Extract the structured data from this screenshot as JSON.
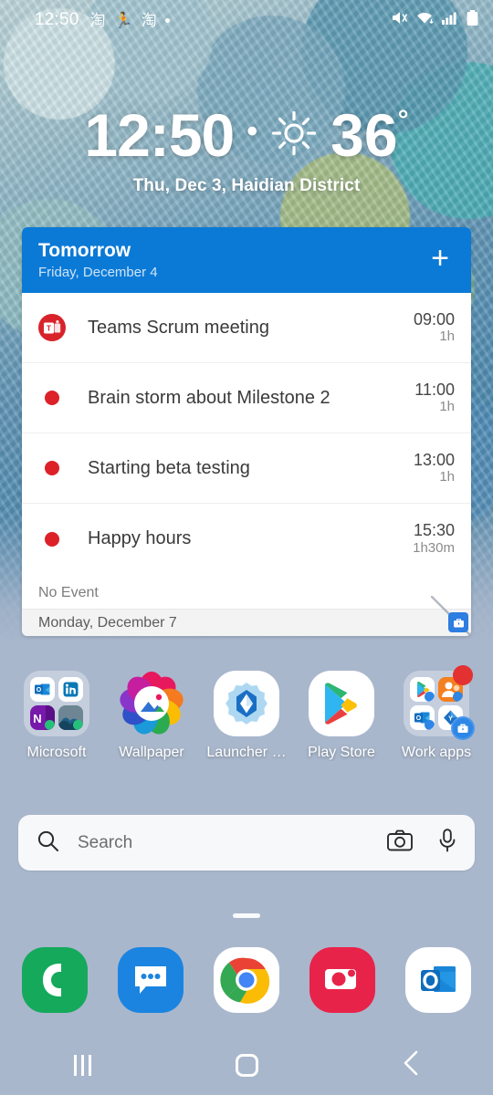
{
  "status_bar": {
    "time": "12:50",
    "notification_icons": [
      "taobao-icon",
      "sports-icon",
      "taobao-icon",
      "dot-icon"
    ],
    "system_icons": [
      "mute-icon",
      "wifi-icon",
      "signal-icon",
      "battery-icon"
    ]
  },
  "clock_widget": {
    "time": "12:50",
    "separator": "•",
    "weather_icon": "sun-icon",
    "temperature": "36",
    "degree": "°",
    "date_location": "Thu, Dec 3,  Haidian District"
  },
  "calendar_widget": {
    "title": "Tomorrow",
    "subtitle": "Friday, December 4",
    "add_label": "+",
    "events": [
      {
        "icon": "teams-icon",
        "title": "Teams Scrum meeting",
        "start": "09:00",
        "duration": "1h"
      },
      {
        "icon": "dot-icon",
        "title": "Brain storm about Milestone 2",
        "start": "11:00",
        "duration": "1h"
      },
      {
        "icon": "dot-icon",
        "title": "Starting beta testing",
        "start": "13:00",
        "duration": "1h"
      },
      {
        "icon": "dot-icon",
        "title": "Happy hours",
        "start": "15:30",
        "duration": "1h30m"
      }
    ],
    "no_event_label": "No Event",
    "footer_date": "Monday, December 7",
    "work_badge_icon": "briefcase-icon",
    "accent_color": "#0b7ad6",
    "event_dot_color": "#dd2128"
  },
  "app_grid": [
    {
      "label": "Microsoft",
      "type": "folder",
      "icon": "microsoft-folder-icon"
    },
    {
      "label": "Wallpaper",
      "type": "app",
      "icon": "wallpaper-icon"
    },
    {
      "label": "Launcher …",
      "type": "app",
      "icon": "launcher-settings-icon"
    },
    {
      "label": "Play Store",
      "type": "app",
      "icon": "play-store-icon"
    },
    {
      "label": "Work apps",
      "type": "folder",
      "icon": "work-apps-folder-icon"
    }
  ],
  "search": {
    "placeholder": "Search",
    "search_icon": "search-icon",
    "camera_icon": "camera-icon",
    "mic_icon": "microphone-icon"
  },
  "dock": [
    {
      "label": "Phone",
      "icon": "phone-icon",
      "color": "#15a95c"
    },
    {
      "label": "Messages",
      "icon": "messages-icon",
      "color": "#1b84e0"
    },
    {
      "label": "Chrome",
      "icon": "chrome-icon",
      "color": "#ffffff"
    },
    {
      "label": "Camera",
      "icon": "camera-app-icon",
      "color": "#e8234a"
    },
    {
      "label": "Outlook",
      "icon": "outlook-icon",
      "color": "#ffffff"
    }
  ],
  "nav_bar": {
    "recents": "recents-icon",
    "home": "home-icon",
    "back": "back-icon"
  }
}
